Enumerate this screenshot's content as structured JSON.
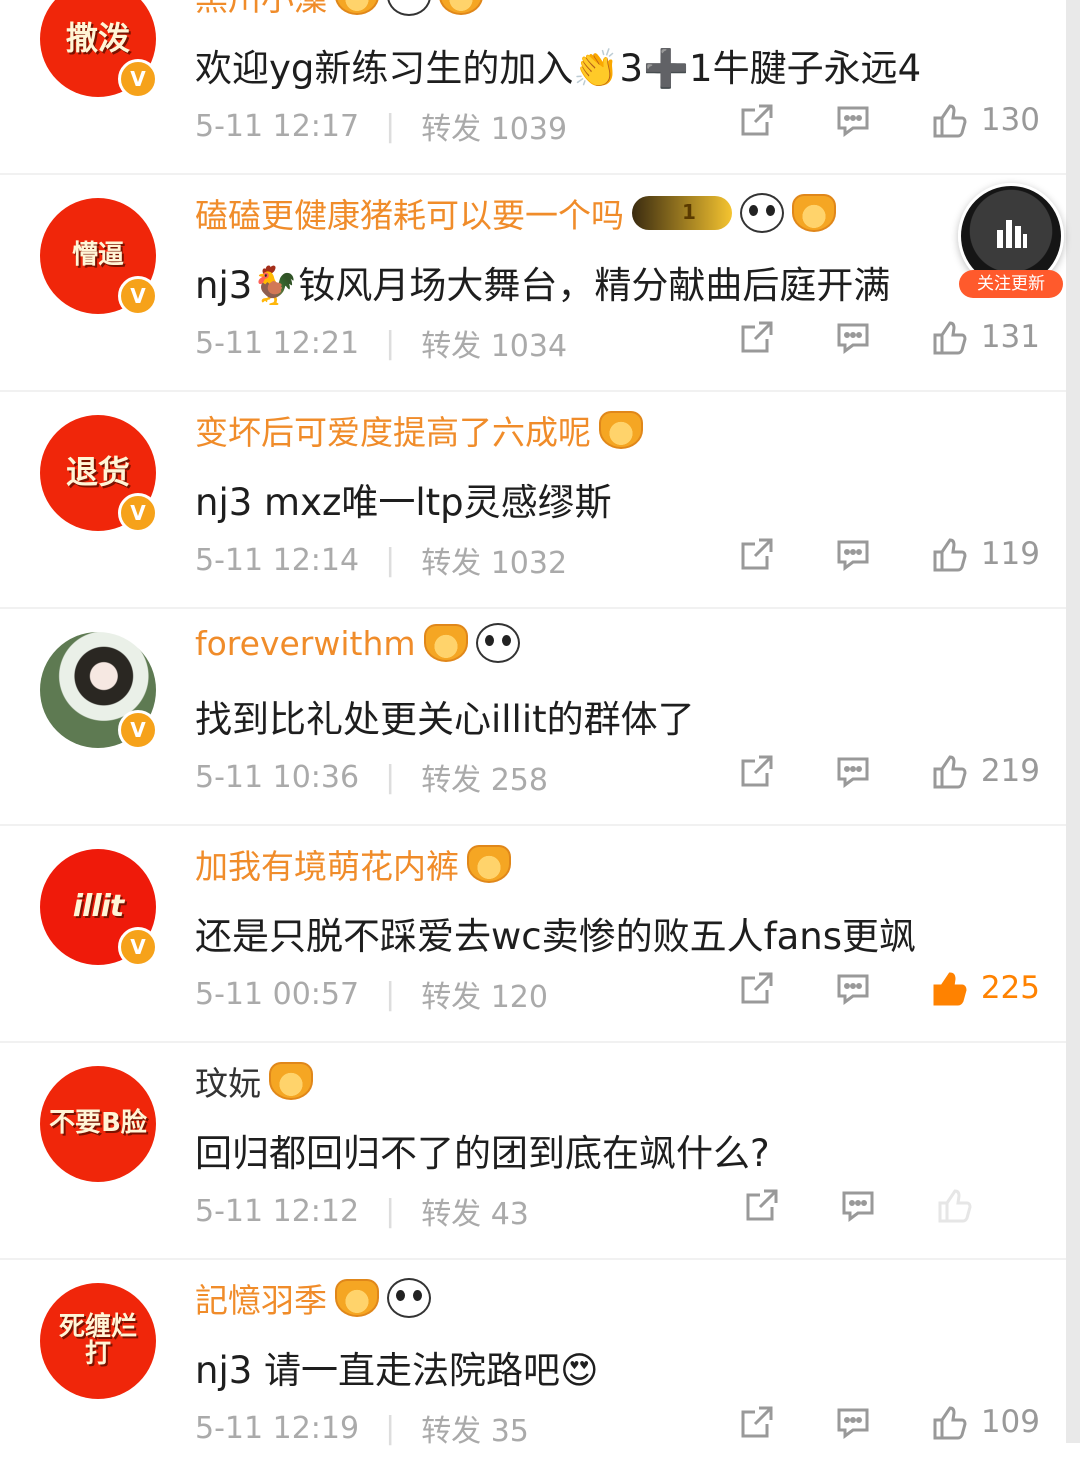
{
  "comments": [
    {
      "avatar_text": "撒泼",
      "username": "黑川小藻",
      "text": "欢迎yg新练习生的加入👏3➕1牛腱子永远4",
      "time": "5-11 12:17",
      "repost": "转发 1039",
      "likes": "130",
      "liked": false
    },
    {
      "avatar_text": "懵逼",
      "username": "磕磕更健康猪耗可以要一个吗",
      "vip_level": "1",
      "text": "nj3🐓钕风月场大舞台，精分献曲后庭开满",
      "time": "5-11 12:21",
      "repost": "转发 1034",
      "likes": "131",
      "liked": false
    },
    {
      "avatar_text": "退货",
      "username": "变坏后可爱度提高了六成呢",
      "text": "nj3 mxz唯一ltp灵感缪斯",
      "time": "5-11 12:14",
      "repost": "转发 1032",
      "likes": "119",
      "liked": false
    },
    {
      "avatar_text": "",
      "username": "foreverwithm",
      "text": "找到比礼处更关心illit的群体了",
      "time": "5-11 10:36",
      "repost": "转发 258",
      "likes": "219",
      "liked": false
    },
    {
      "avatar_text": "illit",
      "username": "加我有境萌花内裤",
      "text": "还是只脱不踩爱去wc卖惨的败五人fans更飒",
      "time": "5-11 00:57",
      "repost": "转发 120",
      "likes": "225",
      "liked": true
    },
    {
      "avatar_text": "不要B脸",
      "username": "玟妧",
      "text": "回归都回归不了的团到底在飒什么?",
      "time": "5-11 12:12",
      "repost": "转发 43",
      "likes": "",
      "liked": false
    },
    {
      "avatar_text": "死缠烂打",
      "username": "記憶羽季",
      "text": "nj3 请一直走法院路吧😍",
      "time": "5-11 12:19",
      "repost": "转发 35",
      "likes": "109",
      "liked": false
    }
  ],
  "floating_button": {
    "label": "关注更新",
    "icon": "music-bars-icon"
  },
  "colors": {
    "username": "#f08c2a",
    "avatar_bg": "#f0260a",
    "liked": "#ff8200",
    "meta": "#aaaaaa"
  },
  "icons": {
    "share": "share-icon",
    "reply": "comment-icon",
    "like": "thumbs-up-icon",
    "verified": "verified-v-icon"
  }
}
